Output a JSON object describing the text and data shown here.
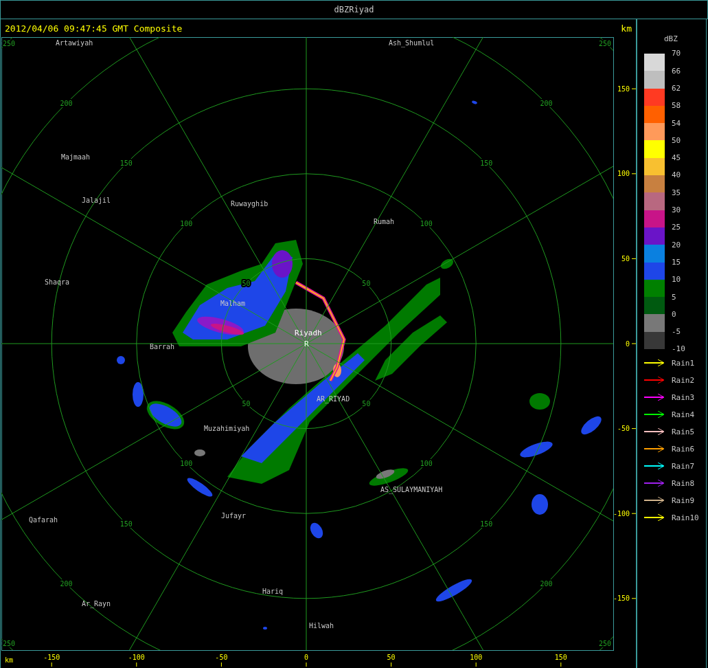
{
  "window": {
    "title": "dBZRiyad"
  },
  "header": {
    "timestamp": "2012/04/06 09:47:45 GMT Composite",
    "unit": "km"
  },
  "range_rings": [
    {
      "labels": [
        "50",
        "50",
        "50",
        "50"
      ]
    },
    {
      "labels": [
        "100",
        "100",
        "100",
        "100"
      ]
    },
    {
      "labels": [
        "150",
        "150",
        "150",
        "150"
      ]
    },
    {
      "labels": [
        "200",
        "200",
        "200",
        "200"
      ]
    },
    {
      "labels": [
        "250",
        "250",
        "250",
        "250"
      ]
    }
  ],
  "places": [
    {
      "name": "Artawiyah",
      "kind": "town"
    },
    {
      "name": "Ash_Shumlul",
      "kind": "town"
    },
    {
      "name": "Majmaah",
      "kind": "town"
    },
    {
      "name": "Jalajil",
      "kind": "town"
    },
    {
      "name": "Ruwayghib",
      "kind": "town"
    },
    {
      "name": "Rumah",
      "kind": "town"
    },
    {
      "name": "Shaqra",
      "kind": "town"
    },
    {
      "name": "Malham",
      "kind": "town"
    },
    {
      "name": "Riyadh",
      "kind": "radar"
    },
    {
      "name": "R",
      "kind": "radar"
    },
    {
      "name": "Barrah",
      "kind": "town"
    },
    {
      "name": "AR_RIYAD",
      "kind": "town"
    },
    {
      "name": "Muzahimiyah",
      "kind": "town"
    },
    {
      "name": "AS_SULAYMANIYAH",
      "kind": "town"
    },
    {
      "name": "Qafarah",
      "kind": "town"
    },
    {
      "name": "Jufayr",
      "kind": "town"
    },
    {
      "name": "Hariq",
      "kind": "town"
    },
    {
      "name": "Ar_Rayn",
      "kind": "town"
    },
    {
      "name": "Hilwah",
      "kind": "town"
    }
  ],
  "y_axis": {
    "ticks": [
      "150",
      "100",
      "50",
      "0",
      "-50",
      "-100",
      "-150"
    ]
  },
  "x_axis": {
    "unit": "km",
    "ticks": [
      "-150",
      "-100",
      "-50",
      "0",
      "50",
      "100",
      "150"
    ]
  },
  "legend": {
    "title": "dBZ",
    "bands": [
      {
        "color": "#d8d8d8"
      },
      {
        "color": "#bebebe"
      },
      {
        "color": "#ff3a22"
      },
      {
        "color": "#ff6000"
      },
      {
        "color": "#ff9a5a"
      },
      {
        "color": "#ffff00"
      },
      {
        "color": "#f8c030"
      },
      {
        "color": "#c88040"
      },
      {
        "color": "#b86880"
      },
      {
        "color": "#c81488"
      },
      {
        "color": "#6a14c8"
      },
      {
        "color": "#0a80e0"
      },
      {
        "color": "#1e46e8"
      },
      {
        "color": "#008000"
      },
      {
        "color": "#005a10"
      },
      {
        "color": "#787878"
      },
      {
        "color": "#383838"
      }
    ],
    "labels": [
      "70",
      "66",
      "62",
      "58",
      "54",
      "50",
      "45",
      "40",
      "35",
      "30",
      "25",
      "20",
      "15",
      "10",
      "5",
      "0",
      "-5",
      "-10"
    ],
    "tracks": [
      {
        "label": "Rain1",
        "color": "#ffff00"
      },
      {
        "label": "Rain2",
        "color": "#ff0000"
      },
      {
        "label": "Rain3",
        "color": "#ff00ff"
      },
      {
        "label": "Rain4",
        "color": "#00ff00"
      },
      {
        "label": "Rain5",
        "color": "#ffc0c0"
      },
      {
        "label": "Rain6",
        "color": "#ffa000"
      },
      {
        "label": "Rain7",
        "color": "#00ffff"
      },
      {
        "label": "Rain8",
        "color": "#a020f0"
      },
      {
        "label": "Rain9",
        "color": "#d2b48c"
      },
      {
        "label": "Rain10",
        "color": "#ffff00"
      }
    ]
  }
}
